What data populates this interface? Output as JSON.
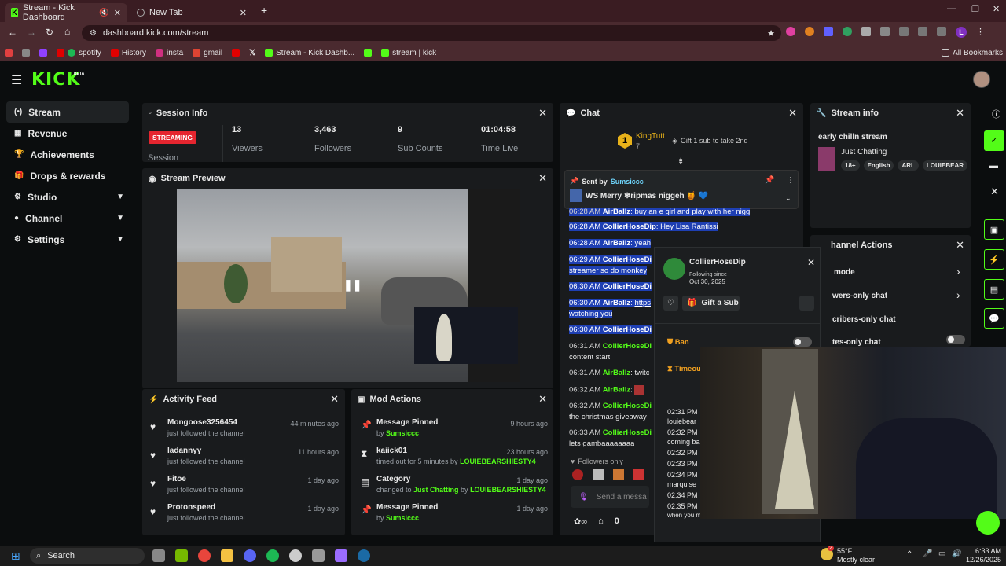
{
  "browser": {
    "tabs": [
      {
        "title": "Stream - Kick Dashboard"
      },
      {
        "title": "New Tab"
      }
    ],
    "url": "dashboard.kick.com/stream",
    "bookmarks": [
      "spotify",
      "History",
      "insta",
      "gmail",
      "",
      "Stream - Kick Dashb...",
      "",
      "stream | kick"
    ],
    "all_bookmarks": "All Bookmarks",
    "profile_letter": "L"
  },
  "app": {
    "logo": "KICK",
    "beta": "BETA"
  },
  "sidebar": {
    "items": [
      {
        "label": "Stream",
        "icon": "broadcast-icon"
      },
      {
        "label": "Revenue",
        "icon": "bank-icon"
      },
      {
        "label": "Achievements",
        "icon": "trophy-icon"
      },
      {
        "label": "Drops & rewards",
        "icon": "gift-icon"
      },
      {
        "label": "Studio",
        "icon": "gear-icon"
      },
      {
        "label": "Channel",
        "icon": "user-icon"
      },
      {
        "label": "Settings",
        "icon": "gear-icon"
      }
    ]
  },
  "session": {
    "title": "Session Info",
    "badge": "STREAMING",
    "badge_label": "Session",
    "stats": [
      {
        "value": "13",
        "label": "Viewers"
      },
      {
        "value": "3,463",
        "label": "Followers"
      },
      {
        "value": "9",
        "label": "Sub Counts"
      },
      {
        "value": "01:04:58",
        "label": "Time Live"
      }
    ]
  },
  "preview": {
    "title": "Stream Preview"
  },
  "activity": {
    "title": "Activity Feed",
    "items": [
      {
        "name": "Mongoose3256454",
        "sub": "just followed the channel",
        "ago": "44 minutes ago"
      },
      {
        "name": "ladannyy",
        "sub": "just followed the channel",
        "ago": "11 hours ago"
      },
      {
        "name": "Fitoe",
        "sub": "just followed the channel",
        "ago": "1 day ago"
      },
      {
        "name": "Protonspeed",
        "sub": "just followed the channel",
        "ago": "1 day ago"
      }
    ]
  },
  "mod": {
    "title": "Mod Actions",
    "items": [
      {
        "title": "Message Pinned",
        "pre": "by ",
        "link": "Sumsiccc",
        "link2": "",
        "ago": "9 hours ago"
      },
      {
        "title": "kaiick01",
        "pre": "timed out for 5 minutes by ",
        "link": "LOUIEBEARSHIESTY4",
        "link2": "",
        "ago": "23 hours ago"
      },
      {
        "title": "Category",
        "pre": "changed to ",
        "link": "Just Chatting",
        "mid": " by ",
        "link2": "LOUIEBEARSHIESTY4",
        "ago": "1 day ago"
      },
      {
        "title": "Message Pinned",
        "pre": "by ",
        "link": "Sumsiccc",
        "link2": "",
        "ago": "1 day ago"
      }
    ]
  },
  "chat": {
    "title": "Chat",
    "top_gifter": "KingTutt",
    "top_gifter_count": "7",
    "top_rank": "1",
    "gift_hint": "Gift 1 sub to take 2nd",
    "pinned": {
      "sent_by": "Sent by",
      "user": "Sumsiccc",
      "text": "WS Merry ❄ripmas niggeh 🍯 💙"
    },
    "messages": [
      {
        "ts": "06:28 AM",
        "user": "AirBallz",
        "text": "buy an e girl and play with her nigga"
      },
      {
        "ts": "06:28 AM",
        "user": "CollierHoseDip",
        "text": "Hey Lisa Rantissi"
      },
      {
        "ts": "06:28 AM",
        "user": "AirBallz",
        "text": "yeah"
      },
      {
        "ts": "06:29 AM",
        "user": "CollierHoseDi",
        "text": ""
      },
      {
        "ts": "",
        "user": "",
        "text": "streamer so do monkey"
      },
      {
        "ts": "06:30 AM",
        "user": "CollierHoseDi",
        "text": ""
      },
      {
        "ts": "06:30 AM",
        "user": "AirBallz",
        "text": "https"
      },
      {
        "ts": "",
        "user": "",
        "text": "watching you"
      },
      {
        "ts": "06:30 AM",
        "user": "CollierHoseDi",
        "text": ""
      },
      {
        "ts": "06:31 AM",
        "user": "CollierHoseDi",
        "text": ""
      },
      {
        "ts": "",
        "user": "",
        "text": "content start"
      },
      {
        "ts": "06:31 AM",
        "user": "AirBallz",
        "text": "twitc"
      },
      {
        "ts": "06:32 AM",
        "user": "AirBallz",
        "text": ""
      },
      {
        "ts": "06:32 AM",
        "user": "CollierHoseDi",
        "text": ""
      },
      {
        "ts": "",
        "user": "",
        "text": "the christmas giveaway"
      },
      {
        "ts": "06:33 AM",
        "user": "CollierHoseDi",
        "text": ""
      },
      {
        "ts": "",
        "user": "",
        "text": "lets gambaaaaaaaa"
      }
    ],
    "followers_only": "Followers only",
    "placeholder": "Send a messa",
    "bottom_count": "0"
  },
  "popup": {
    "user": "CollierHoseDip",
    "following": "Following since",
    "date": "Oct 30, 2025",
    "gift": "Gift a Sub",
    "ban": "Ban",
    "timeout": "Timeou",
    "log": [
      {
        "ts": "02:31 PM",
        "text": "louiebear"
      },
      {
        "ts": "02:32 PM",
        "text": "coming ba"
      },
      {
        "ts": "02:32 PM",
        "text": ""
      },
      {
        "ts": "02:33 PM",
        "text": ""
      },
      {
        "ts": "02:34 PM",
        "text": "marquise"
      },
      {
        "ts": "02:34 PM",
        "text": ""
      },
      {
        "ts": "02:35 PM",
        "text": "when you met Adin for the first time on"
      }
    ]
  },
  "streaminfo": {
    "title": "Stream info",
    "stream_title": "early chilln stream",
    "category": "Just Chatting",
    "tags": [
      "18+",
      "English",
      "ARL",
      "LOUIEBEAR"
    ]
  },
  "channel_actions": {
    "title": "hannel Actions",
    "items": [
      {
        "label": "mode",
        "kind": "arrow"
      },
      {
        "label": "wers-only chat",
        "kind": "arrow"
      },
      {
        "label": "cribers-only chat",
        "kind": "toggle"
      },
      {
        "label": "tes-only chat",
        "kind": "toggle"
      }
    ]
  },
  "taskbar": {
    "search": "Search",
    "weather_temp": "55°F",
    "weather_text": "Mostly clear",
    "time": "6:33 AM",
    "date": "12/26/2025",
    "weather_badge": "2"
  },
  "colors": {
    "kick_green": "#53fc18",
    "streaming_red": "#e5252f",
    "chat_highlight": "#1e3fb3",
    "browser_tab": "#3a1c22"
  }
}
